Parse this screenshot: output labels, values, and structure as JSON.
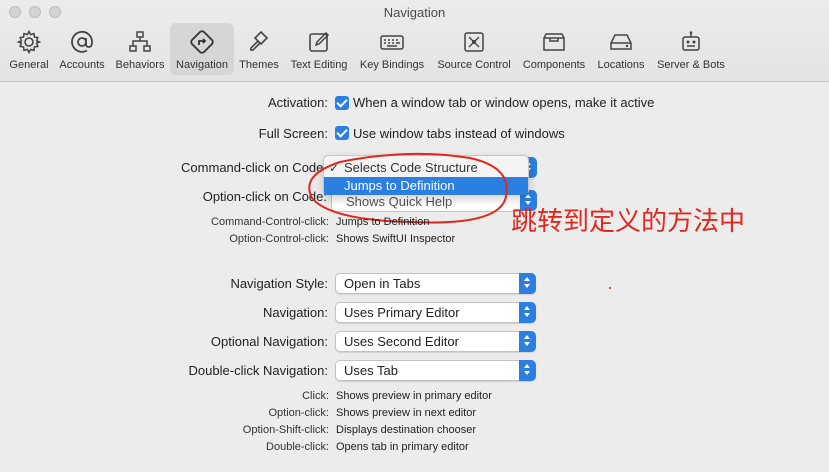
{
  "window": {
    "title": "Navigation"
  },
  "toolbar": {
    "items": [
      {
        "label": "General",
        "icon": "gear-icon"
      },
      {
        "label": "Accounts",
        "icon": "at-sign-icon"
      },
      {
        "label": "Behaviors",
        "icon": "hierarchy-icon"
      },
      {
        "label": "Navigation",
        "icon": "navigation-arrow-icon",
        "selected": true
      },
      {
        "label": "Themes",
        "icon": "paintbrush-icon"
      },
      {
        "label": "Text Editing",
        "icon": "edit-icon"
      },
      {
        "label": "Key Bindings",
        "icon": "keyboard-icon"
      },
      {
        "label": "Source Control",
        "icon": "source-control-icon"
      },
      {
        "label": "Components",
        "icon": "components-icon"
      },
      {
        "label": "Locations",
        "icon": "drive-icon"
      },
      {
        "label": "Server & Bots",
        "icon": "robot-icon"
      }
    ]
  },
  "activation": {
    "label": "Activation:",
    "text": "When a window tab or window opens, make it active",
    "checked": true
  },
  "full_screen": {
    "label": "Full Screen:",
    "text": "Use window tabs instead of windows",
    "checked": true
  },
  "command_click": {
    "label": "Command-click on Code:",
    "menu": [
      {
        "text": "Selects Code Structure",
        "checked": true
      },
      {
        "text": "Jumps to Definition",
        "highlighted": true
      }
    ]
  },
  "option_click": {
    "label": "Option-click on Code:",
    "value": "Shows Quick Help"
  },
  "command_control_click": {
    "label": "Command-Control-click:",
    "value": "Jumps to Definition"
  },
  "option_control_click": {
    "label": "Option-Control-click:",
    "value": "Shows SwiftUI Inspector"
  },
  "navigation_style": {
    "label": "Navigation Style:",
    "value": "Open in Tabs"
  },
  "navigation": {
    "label": "Navigation:",
    "value": "Uses Primary Editor"
  },
  "optional_navigation": {
    "label": "Optional Navigation:",
    "value": "Uses Second Editor"
  },
  "double_click_navigation": {
    "label": "Double-click Navigation:",
    "value": "Uses Tab"
  },
  "summary": [
    {
      "label": "Click:",
      "value": "Shows preview in primary editor"
    },
    {
      "label": "Option-click:",
      "value": "Shows preview in next editor"
    },
    {
      "label": "Option-Shift-click:",
      "value": "Displays destination chooser"
    },
    {
      "label": "Double-click:",
      "value": "Opens tab in primary editor"
    }
  ],
  "annotation": {
    "text": "跳转到定义的方法中",
    "color": "#e0281f"
  },
  "colors": {
    "accent": "#2a7fe0",
    "annotation": "#e0281f"
  }
}
